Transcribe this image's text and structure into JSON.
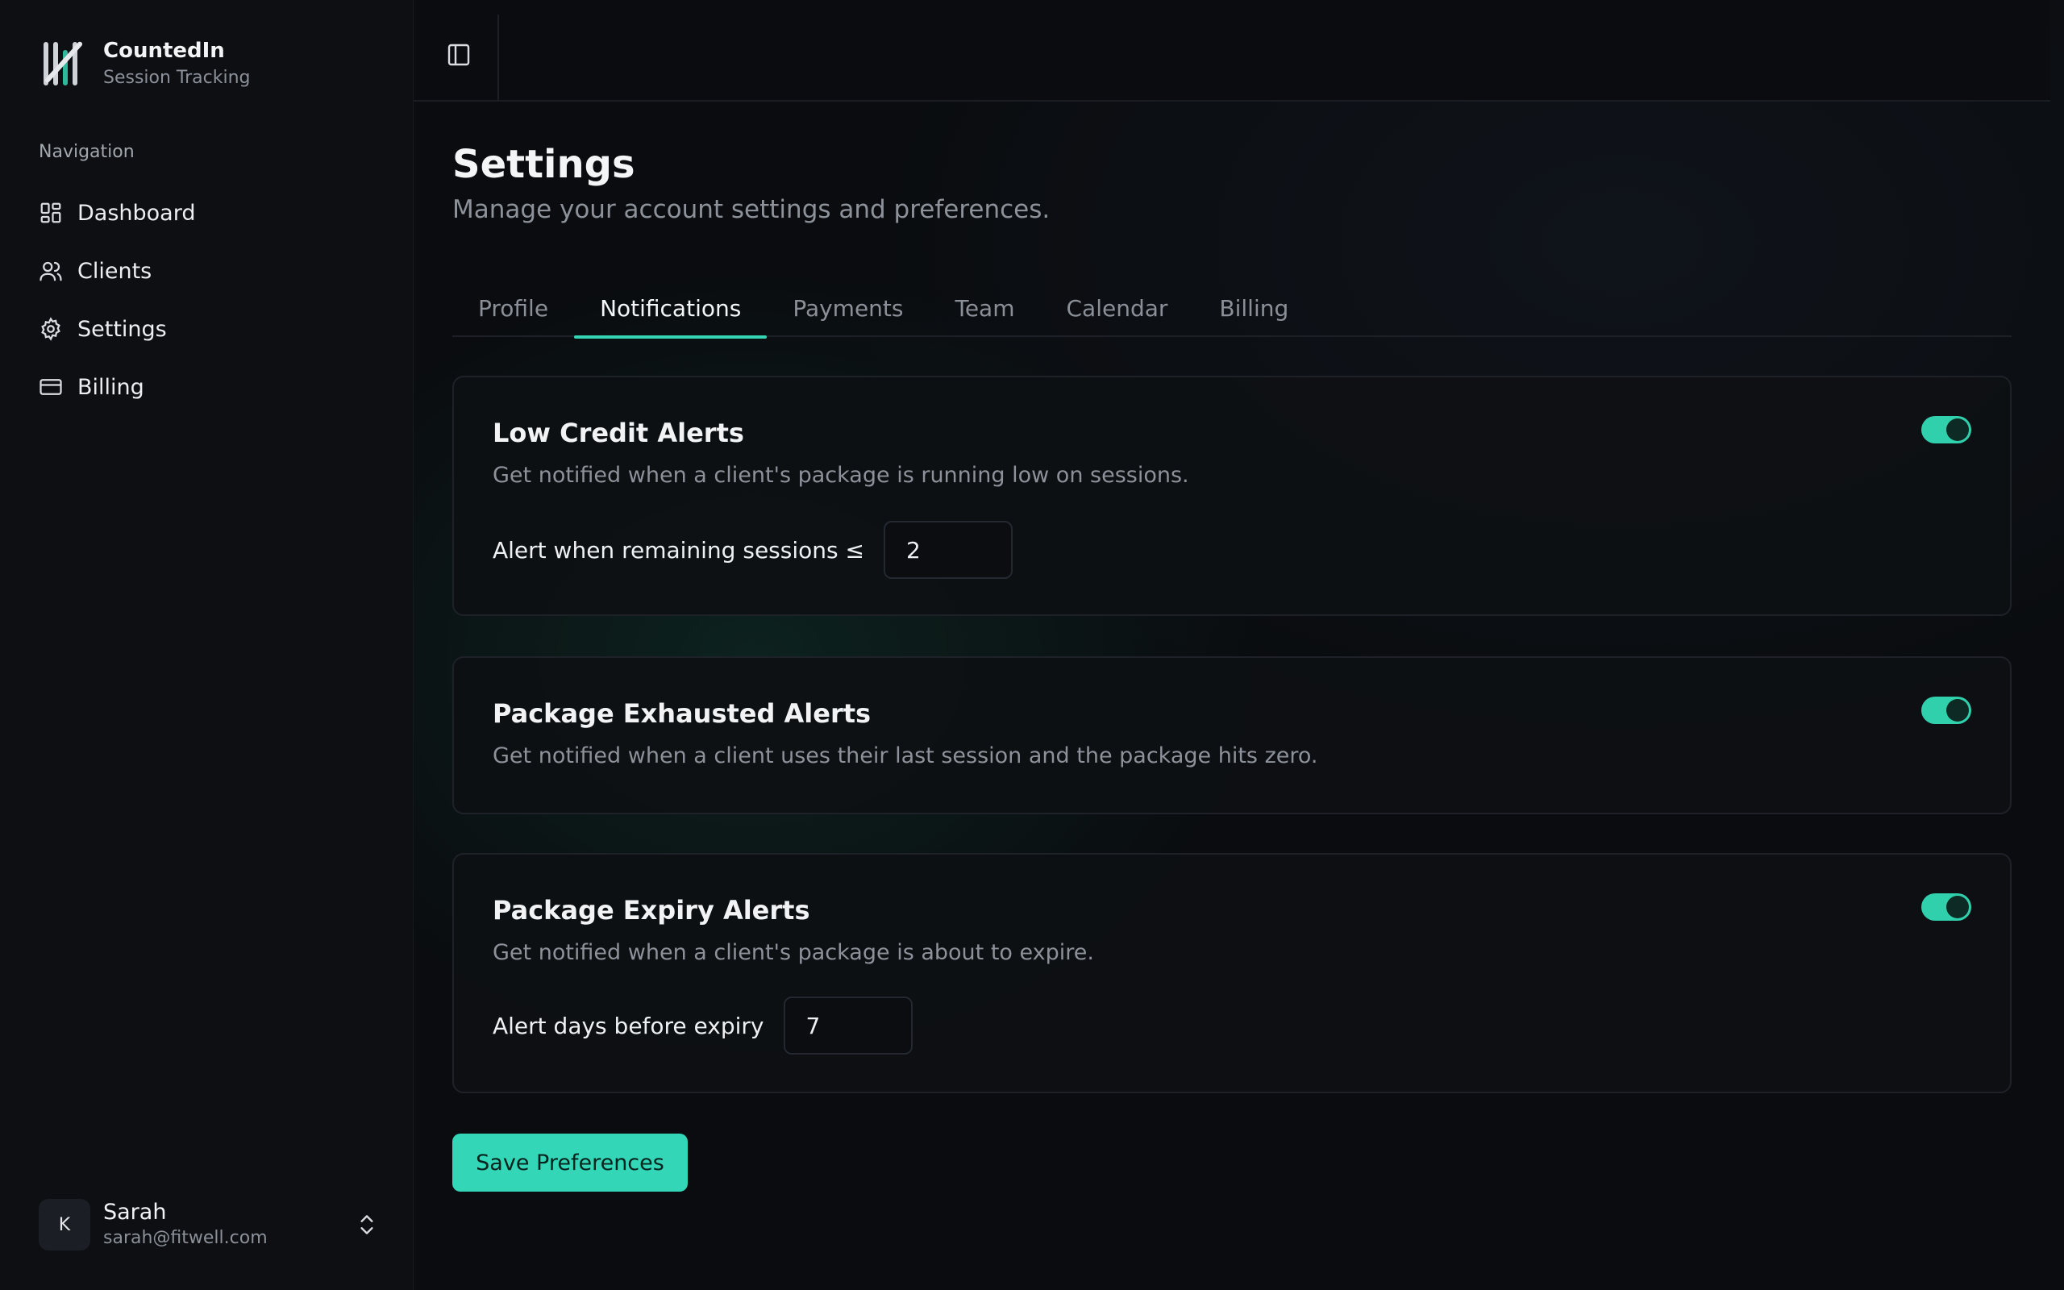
{
  "brand": {
    "name": "CountedIn",
    "subtitle": "Session Tracking"
  },
  "sidebar": {
    "section_label": "Navigation",
    "items": [
      {
        "label": "Dashboard",
        "icon": "dashboard-icon"
      },
      {
        "label": "Clients",
        "icon": "users-icon"
      },
      {
        "label": "Settings",
        "icon": "gear-icon"
      },
      {
        "label": "Billing",
        "icon": "credit-card-icon"
      }
    ]
  },
  "user": {
    "avatar_initial": "K",
    "name": "Sarah",
    "email": "sarah@fitwell.com"
  },
  "page": {
    "title": "Settings",
    "subtitle": "Manage your account settings and preferences."
  },
  "tabs": {
    "items": [
      "Profile",
      "Notifications",
      "Payments",
      "Team",
      "Calendar",
      "Billing"
    ],
    "active": "Notifications"
  },
  "cards": [
    {
      "title": "Low Credit Alerts",
      "description": "Get notified when a client's package is running low on sessions.",
      "enabled": true,
      "field_label": "Alert when remaining sessions ≤",
      "field_value": "2"
    },
    {
      "title": "Package Exhausted Alerts",
      "description": "Get notified when a client uses their last session and the package hits zero.",
      "enabled": true
    },
    {
      "title": "Package Expiry Alerts",
      "description": "Get notified when a client's package is about to expire.",
      "enabled": true,
      "field_label": "Alert days before expiry",
      "field_value": "7"
    }
  ],
  "actions": {
    "save_label": "Save Preferences"
  },
  "colors": {
    "accent": "#33d6b6",
    "background": "#0a0c0f",
    "sidebar": "#0d0f13"
  }
}
